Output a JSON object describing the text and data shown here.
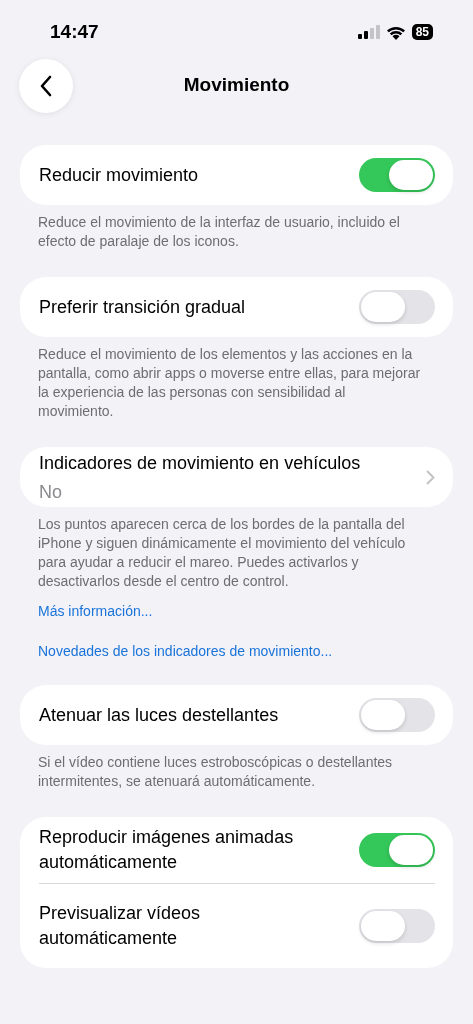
{
  "status_bar": {
    "time": "14:47",
    "battery": "85"
  },
  "nav": {
    "title": "Movimiento"
  },
  "sections": [
    {
      "rows": [
        {
          "kind": "toggle",
          "label": "Reducir movimiento",
          "on": true
        }
      ],
      "footer": [
        {
          "kind": "text",
          "text": "Reduce el movimiento de la interfaz de usuario, incluido el efecto de paralaje de los iconos."
        }
      ]
    },
    {
      "rows": [
        {
          "kind": "toggle",
          "label": "Preferir transición gradual",
          "on": false
        }
      ],
      "footer": [
        {
          "kind": "text",
          "text": "Reduce el movimiento de los elementos y las acciones en la pantalla, como abrir apps o moverse entre ellas, para mejorar la experiencia de las personas con sensibilidad al movimiento."
        }
      ]
    },
    {
      "rows": [
        {
          "kind": "nav",
          "label": "Indicadores de movimiento en vehículos",
          "value": "No"
        }
      ],
      "footer": [
        {
          "kind": "text",
          "text": "Los puntos aparecen cerca de los bordes de la pantalla del iPhone y siguen dinámicamente el movimiento del vehículo para ayudar a reducir el mareo. Puedes activarlos y desactivarlos desde el centro de control."
        },
        {
          "kind": "link",
          "text": "Más información..."
        },
        {
          "kind": "link",
          "text": "Novedades de los indicadores de movimiento..."
        }
      ]
    },
    {
      "rows": [
        {
          "kind": "toggle",
          "label": "Atenuar las luces destellantes",
          "on": false
        }
      ],
      "footer": [
        {
          "kind": "text",
          "text": "Si el vídeo contiene luces estroboscópicas o destellantes intermitentes, se atenuará automáticamente."
        }
      ]
    },
    {
      "rows": [
        {
          "kind": "toggle",
          "label": "Reproducir imágenes animadas automáticamente",
          "on": true
        },
        {
          "kind": "toggle",
          "label": "Previsualizar vídeos automáticamente",
          "on": false
        }
      ]
    }
  ]
}
